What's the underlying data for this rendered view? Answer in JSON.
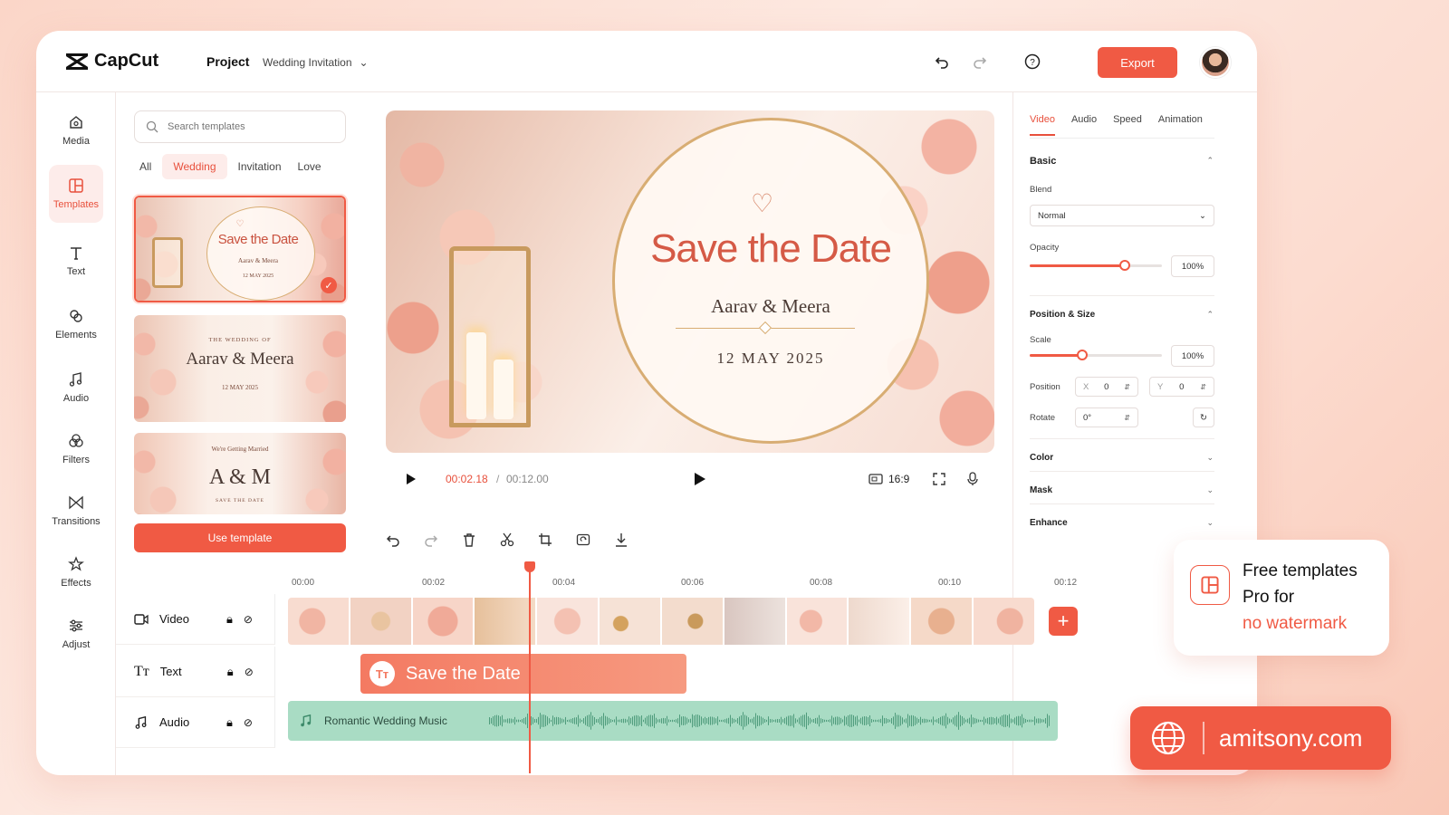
{
  "app": {
    "name": "CapCut",
    "project_label": "Project",
    "project_name": "Wedding Invitation",
    "export_label": "Export"
  },
  "sidebar": {
    "items": [
      {
        "label": "Media",
        "icon": "media-icon"
      },
      {
        "label": "Templates",
        "icon": "templates-icon"
      },
      {
        "label": "Text",
        "icon": "text-icon"
      },
      {
        "label": "Elements",
        "icon": "elements-icon"
      },
      {
        "label": "Audio",
        "icon": "audio-icon"
      },
      {
        "label": "Filters",
        "icon": "filters-icon"
      },
      {
        "label": "Transitions",
        "icon": "transitions-icon"
      },
      {
        "label": "Effects",
        "icon": "effects-icon"
      },
      {
        "label": "Adjust",
        "icon": "adjust-icon"
      }
    ],
    "active": "Templates"
  },
  "templates": {
    "search_placeholder": "Search templates",
    "filters": [
      "All",
      "Wedding",
      "Invitation",
      "Love"
    ],
    "active_filter": "Wedding",
    "cards": [
      {
        "title": "Save the Date",
        "names": "Aarav & Meera",
        "date": "12 MAY 2025"
      },
      {
        "kicker": "THE WEDDING OF",
        "names": "Aarav & Meera",
        "date": "12 MAY 2025"
      },
      {
        "kicker": "We're Getting Married",
        "names": "A & M",
        "footer": "SAVE THE DATE"
      }
    ],
    "use_button": "Use template"
  },
  "preview": {
    "title": "Save the Date",
    "names": "Aarav & Meera",
    "date": "12 MAY 2025"
  },
  "player": {
    "current_time": "00:02.18",
    "separator": "/",
    "duration": "00:12.00",
    "aspect": "16:9"
  },
  "props": {
    "tabs": [
      "Video",
      "Audio",
      "Speed",
      "Animation"
    ],
    "active_tab": "Video",
    "basic": "Basic",
    "blend_label": "Blend",
    "blend_value": "Normal",
    "opacity_label": "Opacity",
    "opacity_value": "100%",
    "opacity_fraction": 0.72,
    "pos_size": "Position & Size",
    "scale_label": "Scale",
    "scale_value": "100%",
    "scale_fraction": 0.4,
    "position_label": "Position",
    "pos_x_label": "X",
    "pos_x": "0",
    "pos_y_label": "Y",
    "pos_y": "0",
    "rotate_label": "Rotate",
    "rotate_value": "0°",
    "color": "Color",
    "mask": "Mask",
    "enhance": "Enhance"
  },
  "timeline": {
    "ticks": [
      "00:00",
      "00:02",
      "00:04",
      "00:06",
      "00:08",
      "00:10",
      "00:12"
    ],
    "tracks": [
      {
        "label": "Video"
      },
      {
        "label": "Text"
      },
      {
        "label": "Audio"
      }
    ],
    "text_clip": "Save the Date",
    "audio_clip": "Romantic Wedding Music"
  },
  "promo": {
    "line1": "Free templates",
    "line2": "Pro for",
    "line3": "no watermark"
  },
  "site": {
    "domain": "amitsony.com"
  },
  "colors": {
    "accent": "#f05a44",
    "audio_clip": "#a9dcc4"
  }
}
